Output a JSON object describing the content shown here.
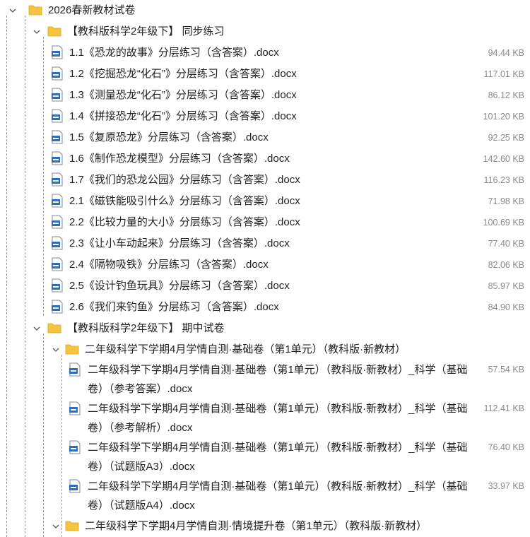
{
  "root": {
    "label": "2026春新教材试卷"
  },
  "folder_sync": {
    "label": "【教科版科学2年级下】 同步练习"
  },
  "sync_files": [
    {
      "name": "1.1《恐龙的故事》分层练习（含答案）.docx",
      "size": "94.44 KB"
    },
    {
      "name": "1.2《挖掘恐龙“化石”》分层练习（含答案）.docx",
      "size": "117.01 KB"
    },
    {
      "name": "1.3《测量恐龙“化石”》分层练习（含答案）.docx",
      "size": "86.12 KB"
    },
    {
      "name": "1.4《拼接恐龙“化石”》分层练习（含答案）.docx",
      "size": "101.20 KB"
    },
    {
      "name": "1.5《复原恐龙》分层练习（含答案）.docx",
      "size": "92.25 KB"
    },
    {
      "name": "1.6《制作恐龙模型》分层练习（含答案）.docx",
      "size": "142.60 KB"
    },
    {
      "name": "1.7《我们的恐龙公园》分层练习（含答案）.docx",
      "size": "116.23 KB"
    },
    {
      "name": "2.1《磁铁能吸引什么》分层练习（含答案）.docx",
      "size": "71.98 KB"
    },
    {
      "name": "2.2《比较力量的大小》分层练习（含答案）.docx",
      "size": "100.69 KB"
    },
    {
      "name": "2.3《让小车动起来》分层练习（含答案）.docx",
      "size": "77.40 KB"
    },
    {
      "name": "2.4《隔物吸铁》分层练习（含答案）.docx",
      "size": "82.06 KB"
    },
    {
      "name": "2.5《设计钓鱼玩具》分层练习（含答案）.docx",
      "size": "85.97 KB"
    },
    {
      "name": "2.6《我们来钓鱼》分层练习（含答案）.docx",
      "size": "84.90 KB"
    }
  ],
  "folder_midterm": {
    "label": "【教科版科学2年级下】 期中试卷"
  },
  "sub_basic": {
    "label": "二年级科学下学期4月学情自测·基础卷（第1单元）（教科版·新教材）"
  },
  "basic_files": [
    {
      "line1": "二年级科学下学期4月学情自测·基础卷（第1单元）（教科版·新教材）_科学（基础",
      "line2": "卷）（参考答案）.docx",
      "size": "57.54 KB"
    },
    {
      "line1": "二年级科学下学期4月学情自测·基础卷（第1单元）（教科版·新教材）_科学（基础",
      "line2": "卷）（参考解析）.docx",
      "size": "112.41 KB"
    },
    {
      "line1": "二年级科学下学期4月学情自测·基础卷（第1单元）（教科版·新教材）_科学（基础",
      "line2": "卷）（试题版A3）.docx",
      "size": "76.40 KB"
    },
    {
      "line1": "二年级科学下学期4月学情自测·基础卷（第1单元）（教科版·新教材）_科学（基础",
      "line2": "卷）（试题版A4）.docx",
      "size": "33.97 KB"
    }
  ],
  "sub_context": {
    "label": "二年级科学下学期4月学情自测·情境提升卷（第1单元）（教科版·新教材）"
  },
  "colors": {
    "folder": "#f5c542",
    "doc_blue": "#2a6ebd",
    "size_text": "#8a8a8a"
  },
  "icons": {
    "expand": "chevron-down-icon",
    "folder": "folder-icon",
    "file": "word-doc-icon"
  }
}
